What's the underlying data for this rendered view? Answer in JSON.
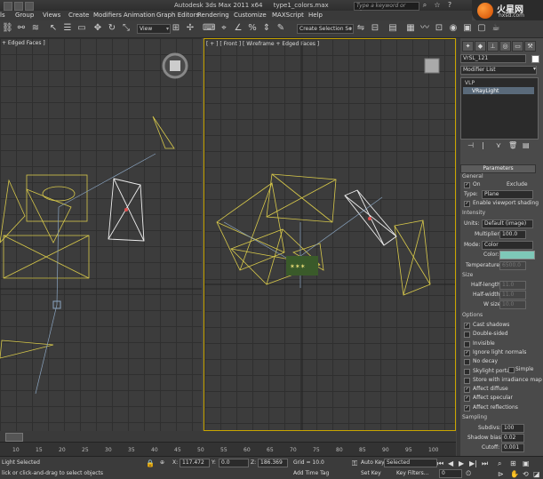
{
  "window": {
    "app_title": "Autodesk 3ds Max  2011 x64",
    "file_name": "type1_colors.max",
    "search_placeholder": "Type a keyword or phrase"
  },
  "watermark": {
    "name": "火星网",
    "url": "hxsd.com"
  },
  "menu": [
    "ls",
    "Group",
    "Views",
    "Create",
    "Modifiers",
    "Animation",
    "Graph Editors",
    "Rendering",
    "Customize",
    "MAXScript",
    "Help"
  ],
  "toolbar": {
    "view_dropdown": "View",
    "selection_set": "Create Selection Se"
  },
  "viewports": {
    "left_label": "+ Edged Faces ]",
    "front_label": "[ + ] [ Front ] [ Wireframe + Edged Faces ]"
  },
  "command_panel": {
    "object_name": "VrSL_121",
    "modifier_list": "Modifier List",
    "stack": [
      "VLP",
      "VRayLight"
    ],
    "parameters": {
      "header": "Parameters",
      "general": "General",
      "on_label": "On",
      "exclude": "Exclude",
      "type_label": "Type:",
      "type_value": "Plane",
      "enable_viewport": "Enable viewport shading",
      "intensity": "Intensity",
      "units_label": "Units:",
      "units_value": "Default (image)",
      "multiplier_label": "Multiplier:",
      "multiplier_value": "100.0",
      "mode_label": "Mode:",
      "mode_value": "Color",
      "color_label": "Color:",
      "color_swatch": "#7ec8b8",
      "temperature_label": "Temperature:",
      "temperature_value": "6500.0",
      "size": "Size",
      "half_length_label": "Half-length:",
      "half_length_value": "11.0",
      "half_width_label": "Half-width:",
      "half_width_value": "11.0",
      "w_size_label": "W size",
      "w_size_value": "10.0",
      "options": "Options",
      "opts": [
        {
          "label": "Cast shadows",
          "checked": true
        },
        {
          "label": "Double-sided",
          "checked": false
        },
        {
          "label": "Invisible",
          "checked": false
        },
        {
          "label": "Ignore light normals",
          "checked": true
        },
        {
          "label": "No decay",
          "checked": false
        },
        {
          "label": "Skylight portal",
          "checked": false
        },
        {
          "label": "Store with irradiance map",
          "checked": false
        },
        {
          "label": "Affect diffuse",
          "checked": true
        },
        {
          "label": "Affect specular",
          "checked": true
        },
        {
          "label": "Affect reflections",
          "checked": true
        }
      ],
      "simple": "Simple",
      "sampling": "Sampling",
      "subdivs_label": "Subdivs:",
      "subdivs_value": "100",
      "shadow_bias_label": "Shadow bias:",
      "shadow_bias_value": "0.02",
      "cutoff_label": "Cutoff:",
      "cutoff_value": "0.001"
    }
  },
  "timeline": {
    "ticks": [
      "10",
      "15",
      "20",
      "25",
      "30",
      "35",
      "40",
      "45",
      "50",
      "55",
      "60",
      "65",
      "70",
      "75",
      "80",
      "85",
      "90",
      "95",
      "100"
    ]
  },
  "status": {
    "selection": "Light Selected",
    "prompt": "lick or click-and-drag to select objects",
    "x_value": "117.472",
    "y_value": "0.0",
    "z_value": "186.369",
    "grid": "Grid = 10.0",
    "add_time_tag": "Add Time Tag",
    "auto_key": "Auto Key",
    "set_key": "Set Key",
    "selected": "Selected",
    "key_filters": "Key Filters...",
    "frame": "0"
  }
}
